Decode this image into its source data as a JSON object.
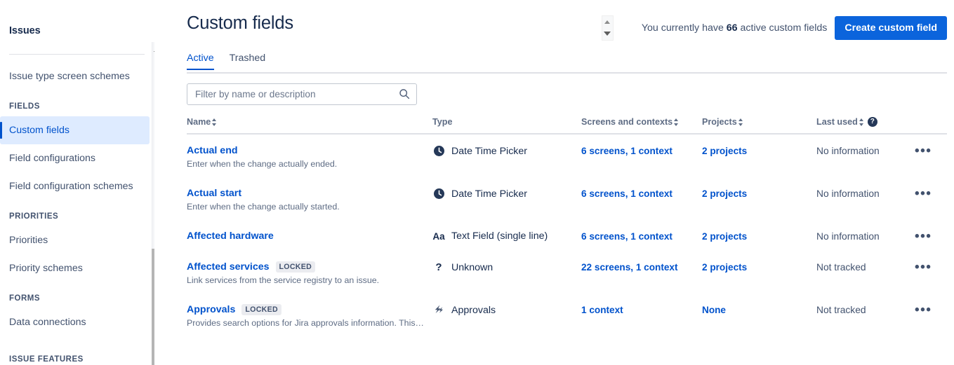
{
  "sidebar": {
    "title": "Issues",
    "items": [
      {
        "type": "link",
        "label": "Issue type screen schemes",
        "selected": false
      },
      {
        "type": "section",
        "label": "FIELDS"
      },
      {
        "type": "link",
        "label": "Custom fields",
        "selected": true
      },
      {
        "type": "link",
        "label": "Field configurations",
        "selected": false
      },
      {
        "type": "link",
        "label": "Field configuration schemes",
        "selected": false
      },
      {
        "type": "section",
        "label": "PRIORITIES"
      },
      {
        "type": "link",
        "label": "Priorities",
        "selected": false
      },
      {
        "type": "link",
        "label": "Priority schemes",
        "selected": false
      },
      {
        "type": "section",
        "label": "FORMS"
      },
      {
        "type": "link",
        "label": "Data connections",
        "selected": false
      }
    ],
    "cutoff_section": "ISSUE FEATURES"
  },
  "header": {
    "title": "Custom fields",
    "count_prefix": "You currently have",
    "count_value": "66",
    "count_suffix": "active custom fields",
    "create_button": "Create custom field"
  },
  "tabs": [
    {
      "label": "Active",
      "active": true
    },
    {
      "label": "Trashed",
      "active": false
    }
  ],
  "search": {
    "placeholder": "Filter by name or description",
    "value": ""
  },
  "table": {
    "columns": [
      {
        "label": "Name",
        "sortable": true,
        "help": false
      },
      {
        "label": "Type",
        "sortable": false,
        "help": false
      },
      {
        "label": "Screens and contexts",
        "sortable": true,
        "help": false
      },
      {
        "label": "Projects",
        "sortable": true,
        "help": false
      },
      {
        "label": "Last used",
        "sortable": true,
        "help": true
      }
    ],
    "help_glyph": "?",
    "actions_glyph": "•••",
    "rows": [
      {
        "name": "Actual end",
        "locked": false,
        "description": "Enter when the change actually ended.",
        "type_icon": "clock-icon",
        "type": "Date Time Picker",
        "screens": "6 screens, 1 context",
        "projects": "2 projects",
        "projects_link": true,
        "last_used": "No information"
      },
      {
        "name": "Actual start",
        "locked": false,
        "description": "Enter when the change actually started.",
        "type_icon": "clock-icon",
        "type": "Date Time Picker",
        "screens": "6 screens, 1 context",
        "projects": "2 projects",
        "projects_link": true,
        "last_used": "No information"
      },
      {
        "name": "Affected hardware",
        "locked": false,
        "description": "",
        "type_icon": "text-aa-icon",
        "type": "Text Field (single line)",
        "screens": "6 screens, 1 context",
        "projects": "2 projects",
        "projects_link": true,
        "last_used": "No information"
      },
      {
        "name": "Affected services",
        "locked": true,
        "locked_label": "LOCKED",
        "description": "Link services from the service registry to an issue.",
        "type_icon": "question-mark-icon",
        "type": "Unknown",
        "screens": "22 screens, 1 context",
        "projects": "2 projects",
        "projects_link": true,
        "last_used": "Not tracked"
      },
      {
        "name": "Approvals",
        "locked": true,
        "locked_label": "LOCKED",
        "description": "Provides search options for Jira approvals information. This custom...",
        "type_icon": "approvals-bolt-icon",
        "type": "Approvals",
        "screens": "1 context",
        "projects": "None",
        "projects_link": true,
        "last_used": "Not tracked"
      }
    ]
  },
  "colors": {
    "link": "#0052CC",
    "primary_button": "#0B64DC",
    "selected_nav_bg": "#DEEBFF",
    "text": "#172B4D",
    "muted": "#5E6C84"
  }
}
